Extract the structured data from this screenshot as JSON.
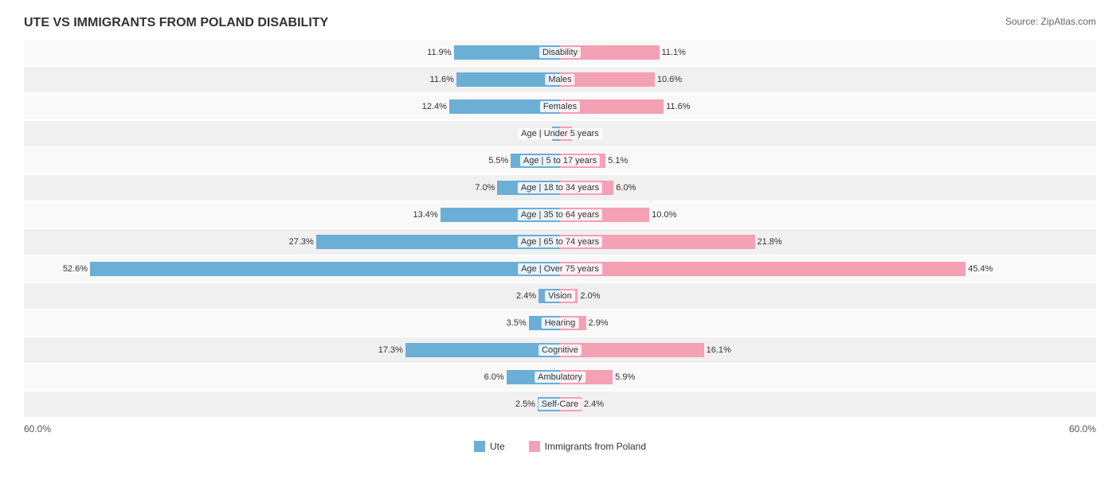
{
  "title": "UTE VS IMMIGRANTS FROM POLAND DISABILITY",
  "source": "Source: ZipAtlas.com",
  "axis_left": "60.0%",
  "axis_right": "60.0%",
  "legend": {
    "ute_label": "Ute",
    "poland_label": "Immigrants from Poland"
  },
  "rows": [
    {
      "label": "Disability",
      "left_val": 11.9,
      "right_val": 11.1,
      "left_pct": "11.9%",
      "right_pct": "11.1%"
    },
    {
      "label": "Males",
      "left_val": 11.6,
      "right_val": 10.6,
      "left_pct": "11.6%",
      "right_pct": "10.6%"
    },
    {
      "label": "Females",
      "left_val": 12.4,
      "right_val": 11.6,
      "left_pct": "12.4%",
      "right_pct": "11.6%"
    },
    {
      "label": "Age | Under 5 years",
      "left_val": 0.86,
      "right_val": 1.3,
      "left_pct": "0.86%",
      "right_pct": "1.3%"
    },
    {
      "label": "Age | 5 to 17 years",
      "left_val": 5.5,
      "right_val": 5.1,
      "left_pct": "5.5%",
      "right_pct": "5.1%"
    },
    {
      "label": "Age | 18 to 34 years",
      "left_val": 7.0,
      "right_val": 6.0,
      "left_pct": "7.0%",
      "right_pct": "6.0%"
    },
    {
      "label": "Age | 35 to 64 years",
      "left_val": 13.4,
      "right_val": 10.0,
      "left_pct": "13.4%",
      "right_pct": "10.0%"
    },
    {
      "label": "Age | 65 to 74 years",
      "left_val": 27.3,
      "right_val": 21.8,
      "left_pct": "27.3%",
      "right_pct": "21.8%"
    },
    {
      "label": "Age | Over 75 years",
      "left_val": 52.6,
      "right_val": 45.4,
      "left_pct": "52.6%",
      "right_pct": "45.4%"
    },
    {
      "label": "Vision",
      "left_val": 2.4,
      "right_val": 2.0,
      "left_pct": "2.4%",
      "right_pct": "2.0%"
    },
    {
      "label": "Hearing",
      "left_val": 3.5,
      "right_val": 2.9,
      "left_pct": "3.5%",
      "right_pct": "2.9%"
    },
    {
      "label": "Cognitive",
      "left_val": 17.3,
      "right_val": 16.1,
      "left_pct": "17.3%",
      "right_pct": "16.1%"
    },
    {
      "label": "Ambulatory",
      "left_val": 6.0,
      "right_val": 5.9,
      "left_pct": "6.0%",
      "right_pct": "5.9%"
    },
    {
      "label": "Self-Care",
      "left_val": 2.5,
      "right_val": 2.4,
      "left_pct": "2.5%",
      "right_pct": "2.4%"
    }
  ],
  "max_val": 60.0
}
